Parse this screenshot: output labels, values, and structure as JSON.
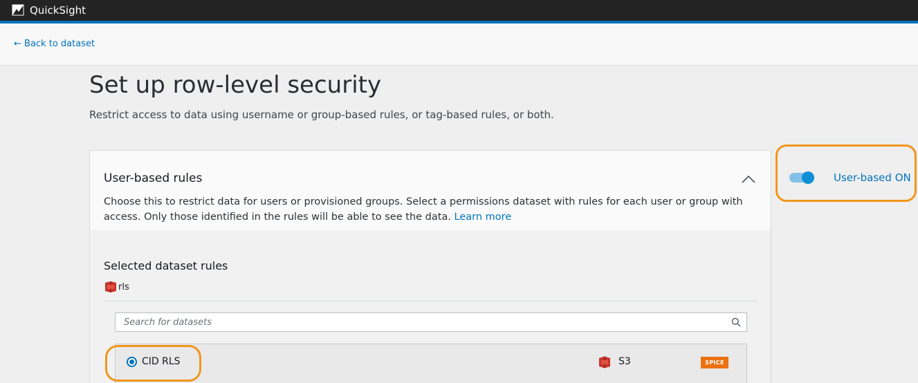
{
  "app": {
    "title": "QuickSight"
  },
  "nav": {
    "back_label": "← Back to dataset"
  },
  "page": {
    "title": "Set up row-level security",
    "subtitle": "Restrict access to data using username or group-based rules, or tag-based rules, or both."
  },
  "user_rules": {
    "title": "User-based rules",
    "description": "Choose this to restrict data for users or provisioned groups. Select a permissions dataset with rules for each user or group with access. Only those identified in the rules will be able to see the data.",
    "learn_more": "Learn more",
    "toggle_label": "User-based ON",
    "toggle_on": true,
    "selected_title": "Selected dataset rules",
    "selected_dataset": "rls",
    "search": {
      "placeholder": "Search for datasets",
      "value": ""
    },
    "datasets": [
      {
        "name": "CID RLS",
        "source": "S3",
        "badge": "SPICE",
        "selected": true
      }
    ]
  },
  "colors": {
    "accent": "#0073bb",
    "highlight": "#f0961b",
    "badge": "#ec7211",
    "topbar": "#232323"
  },
  "icons": [
    "quicksight-logo-icon",
    "chevron-up-icon",
    "s3-bucket-icon",
    "search-icon"
  ]
}
